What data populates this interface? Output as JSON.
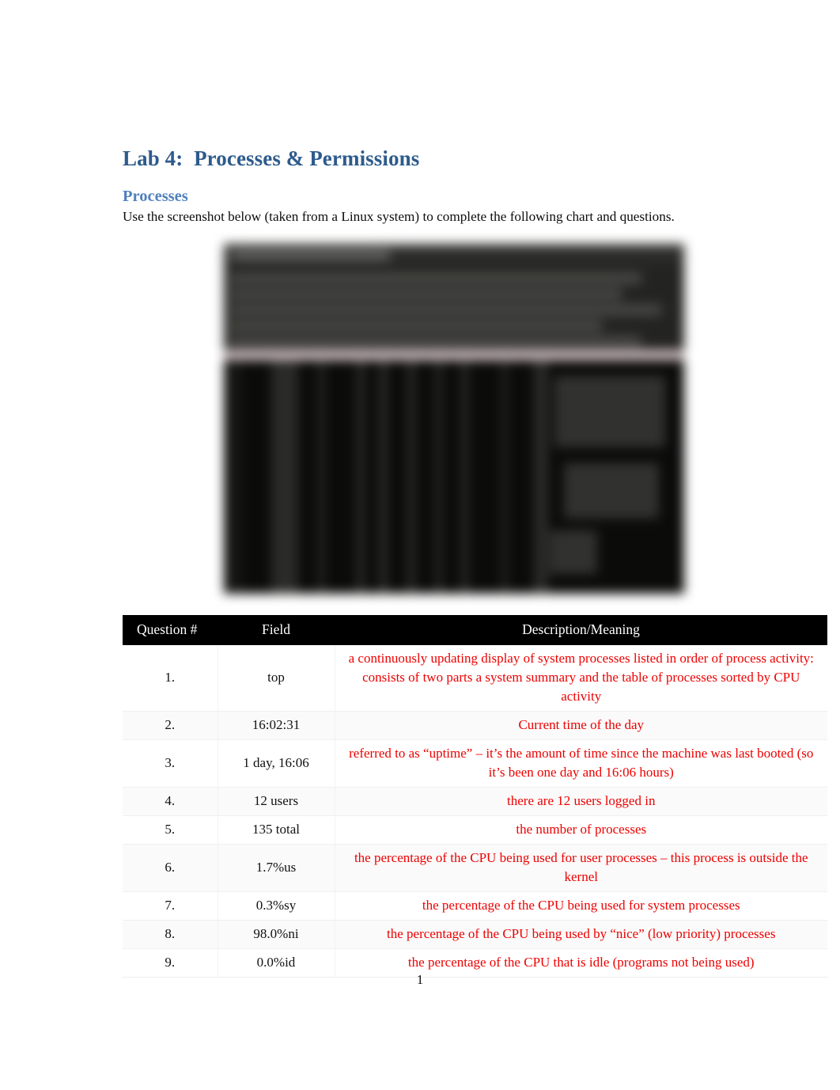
{
  "document": {
    "title": "Lab 4:  Processes & Permissions",
    "section_heading": "Processes",
    "intro_paragraph": "Use the screenshot below (taken from a Linux system) to complete the following chart and questions.",
    "page_number": "1",
    "colors": {
      "title_blue": "#2E5B8C",
      "heading_blue": "#4F81BD",
      "answer_red": "#EE0000",
      "table_header_bg": "#000000",
      "table_header_text": "#FFFFFF"
    }
  },
  "screenshot": {
    "alt": "blurred terminal screenshot of the Linux top command output"
  },
  "table": {
    "headers": [
      "Question #",
      "Field",
      "Description/Meaning"
    ],
    "rows": [
      {
        "number": "1.",
        "field": "top",
        "description": "a continuously updating display of system processes listed in order of process activity: consists of two parts a system summary and the table of processes sorted by CPU activity"
      },
      {
        "number": "2.",
        "field": "16:02:31",
        "description": "Current time of the day"
      },
      {
        "number": "3.",
        "field": "1 day, 16:06",
        "description": "referred to as “uptime” – it’s the amount of time since the machine was last booted (so it’s been one day and 16:06 hours)"
      },
      {
        "number": "4.",
        "field": "12 users",
        "description": "there are 12 users logged in"
      },
      {
        "number": "5.",
        "field": "135 total",
        "description": "the number of processes"
      },
      {
        "number": "6.",
        "field": "1.7%us",
        "description": "the percentage of the CPU being used for user processes – this process is outside the kernel"
      },
      {
        "number": "7.",
        "field": "0.3%sy",
        "description": "the percentage of the CPU being used for system processes"
      },
      {
        "number": "8.",
        "field": "98.0%ni",
        "description": "the percentage of the CPU being used by “nice” (low priority) processes"
      },
      {
        "number": "9.",
        "field": "0.0%id",
        "description": "the percentage of the CPU that is idle (programs not being used)"
      }
    ]
  }
}
